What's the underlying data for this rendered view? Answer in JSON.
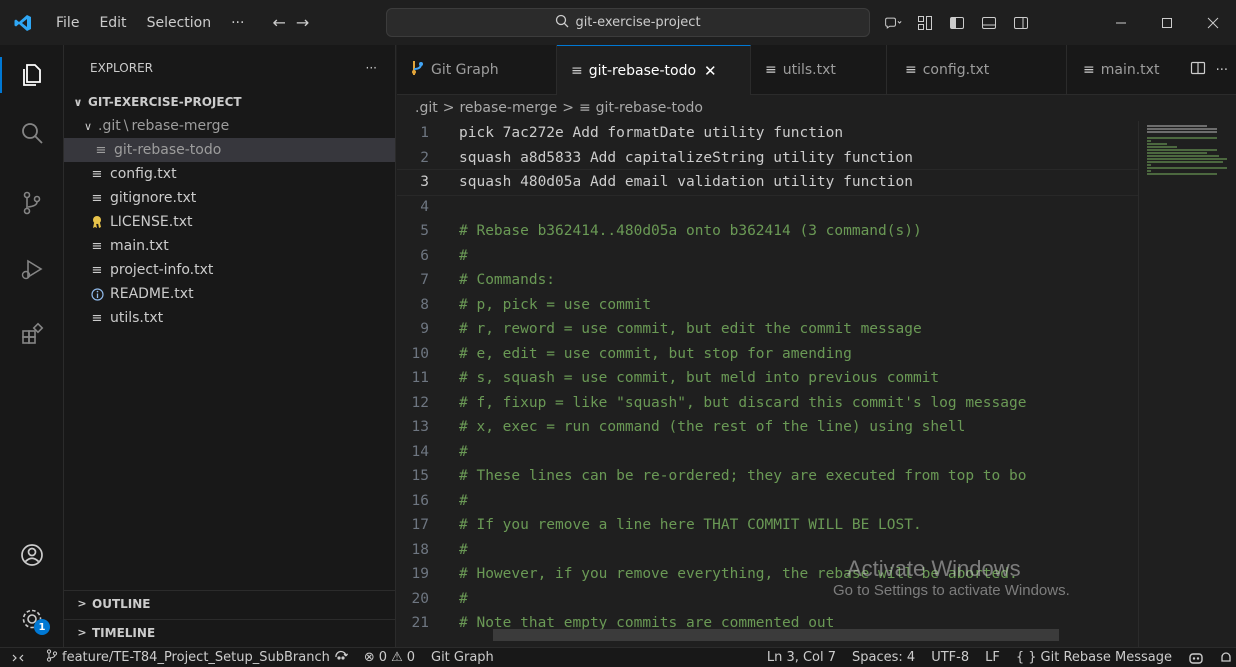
{
  "titlebar": {
    "menu": [
      "File",
      "Edit",
      "Selection",
      "···"
    ],
    "search_text": "git-exercise-project"
  },
  "sidebar": {
    "title": "EXPLORER",
    "more": "···",
    "project": "GIT-EXERCISE-PROJECT",
    "folder_prefix": ".git",
    "folder_suffix": "rebase-merge",
    "selected_file": "git-rebase-todo",
    "files": [
      "config.txt",
      "gitignore.txt",
      "LICENSE.txt",
      "main.txt",
      "project-info.txt",
      "README.txt",
      "utils.txt"
    ],
    "outline": "OUTLINE",
    "timeline": "TIMELINE"
  },
  "tabs": [
    {
      "label": "Git Graph"
    },
    {
      "label": "git-rebase-todo"
    },
    {
      "label": "utils.txt"
    },
    {
      "label": "config.txt"
    },
    {
      "label": "main.txt"
    }
  ],
  "breadcrumb": [
    ".git",
    "rebase-merge",
    "git-rebase-todo"
  ],
  "editor": {
    "current_line": 3,
    "lines": [
      {
        "n": "1",
        "text": "pick 7ac272e Add formatDate utility function",
        "comment": false
      },
      {
        "n": "2",
        "text": "squash a8d5833 Add capitalizeString utility function",
        "comment": false
      },
      {
        "n": "3",
        "text": "squash 480d05a Add email validation utility function",
        "comment": false
      },
      {
        "n": "4",
        "text": "",
        "comment": false
      },
      {
        "n": "5",
        "text": "# Rebase b362414..480d05a onto b362414 (3 command(s))",
        "comment": true
      },
      {
        "n": "6",
        "text": "#",
        "comment": true
      },
      {
        "n": "7",
        "text": "# Commands:",
        "comment": true
      },
      {
        "n": "8",
        "text": "# p, pick = use commit",
        "comment": true
      },
      {
        "n": "9",
        "text": "# r, reword = use commit, but edit the commit message",
        "comment": true
      },
      {
        "n": "10",
        "text": "# e, edit = use commit, but stop for amending",
        "comment": true
      },
      {
        "n": "11",
        "text": "# s, squash = use commit, but meld into previous commit",
        "comment": true
      },
      {
        "n": "12",
        "text": "# f, fixup = like \"squash\", but discard this commit's log message",
        "comment": true
      },
      {
        "n": "13",
        "text": "# x, exec = run command (the rest of the line) using shell",
        "comment": true
      },
      {
        "n": "14",
        "text": "#",
        "comment": true
      },
      {
        "n": "15",
        "text": "# These lines can be re-ordered; they are executed from top to bo",
        "comment": true
      },
      {
        "n": "16",
        "text": "#",
        "comment": true
      },
      {
        "n": "17",
        "text": "# If you remove a line here THAT COMMIT WILL BE LOST.",
        "comment": true
      },
      {
        "n": "18",
        "text": "#",
        "comment": true
      },
      {
        "n": "19",
        "text": "# However, if you remove everything, the rebase will be aborted.",
        "comment": true
      },
      {
        "n": "20",
        "text": "#",
        "comment": true
      },
      {
        "n": "21",
        "text": "# Note that empty commits are commented out",
        "comment": true
      }
    ]
  },
  "watermark": {
    "line1": "Activate Windows",
    "line2": "Go to Settings to activate Windows."
  },
  "statusbar": {
    "branch": "feature/TE-T84_Project_Setup_SubBranch",
    "errors": "0",
    "warnings": "0",
    "git_graph": "Git Graph",
    "position": "Ln 3, Col 7",
    "spaces": "Spaces: 4",
    "encoding": "UTF-8",
    "eol": "LF",
    "language": "Git Rebase Message"
  },
  "notification_count": "1",
  "colors": {
    "accent": "#0078d4",
    "comment": "#6a9955",
    "background": "#1f1f1f",
    "sidebar": "#181818"
  }
}
